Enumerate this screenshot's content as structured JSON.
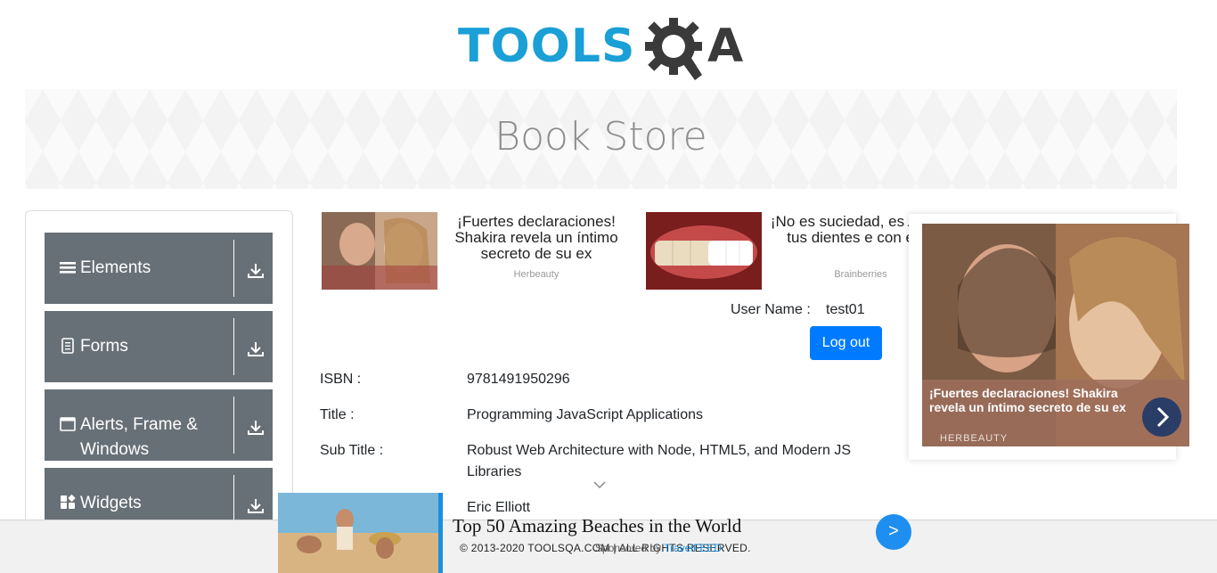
{
  "header": {
    "logo_tools": "TOOLS",
    "logo_qa": "A"
  },
  "banner": {
    "title": "Book Store"
  },
  "sidebar": {
    "groups": [
      {
        "label": "Elements",
        "icon": "list-icon"
      },
      {
        "label": "Forms",
        "icon": "document-icon"
      },
      {
        "label": "Alerts, Frame & Windows",
        "icon": "window-icon"
      },
      {
        "label": "Widgets",
        "icon": "widgets-icon"
      }
    ]
  },
  "ads": [
    {
      "text": "¡Fuertes declaraciones! Shakira revela un íntimo secreto de su ex",
      "source": "Herbeauty"
    },
    {
      "text": "¡No es suciedad, es Aclara tus dientes e con esto",
      "source": "Brainberries"
    }
  ],
  "user": {
    "label": "User Name :",
    "value": "test01",
    "logout_label": "Log out"
  },
  "book": {
    "isbn_label": "ISBN :",
    "isbn": "9781491950296",
    "title_label": "Title :",
    "title": "Programming JavaScript Applications",
    "subtitle_label": "Sub Title :",
    "subtitle": "Robust Web Architecture with Node, HTML5, and Modern JS Libraries",
    "author": "Eric Elliott"
  },
  "popup_ad": {
    "caption": "¡Fuertes declaraciones! Shakira revela un íntimo secreto de su ex",
    "source": "HERBEAUTY"
  },
  "bottom_ad": {
    "title": "Top 50 Amazing Beaches in the World",
    "button": ">"
  },
  "footer": {
    "copyright": "© 2013-2020 TOOLSQA.COM | ALL RIGHTS RESERVED.",
    "sponsored": "Sponsored by",
    "sponsor_name": "TravelFEED"
  },
  "colors": {
    "brand_blue": "#1a9fd6",
    "sidebar_group": "#687077",
    "primary_button": "#007bff"
  }
}
